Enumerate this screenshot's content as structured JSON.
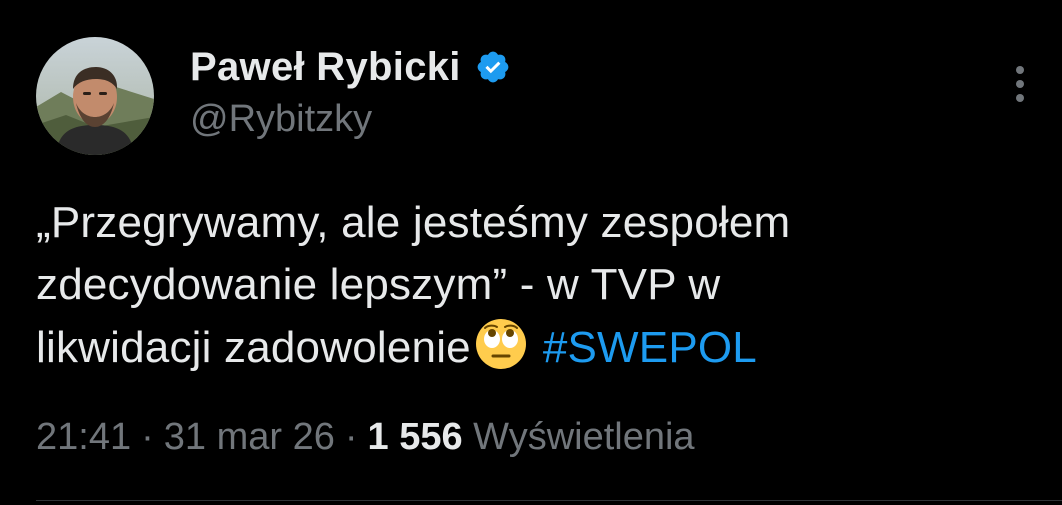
{
  "author": {
    "display_name": "Paweł Rybicki",
    "handle": "@Rybitzky",
    "verified": true,
    "avatar_icon": "profile-photo",
    "verified_icon": "verified-badge-icon"
  },
  "tweet": {
    "text_lines": [
      "„Przegrywamy, ale jesteśmy zespołem",
      "zdecydowanie lepszym” - w TVP w",
      "likwidacji zadowolenie"
    ],
    "emoji": "face-with-rolling-eyes-icon",
    "hashtag": "#SWEPOL"
  },
  "meta": {
    "time": "21:41",
    "separator": "·",
    "date": "31 mar 26",
    "views_count": "1 556",
    "views_label": "Wyświetlenia"
  },
  "more_icon": "more-vertical-icon",
  "colors": {
    "background": "#000000",
    "primary_text": "#e7e9ea",
    "secondary_text": "#71767b",
    "accent": "#1d9bf0",
    "divider": "#2f3336"
  }
}
